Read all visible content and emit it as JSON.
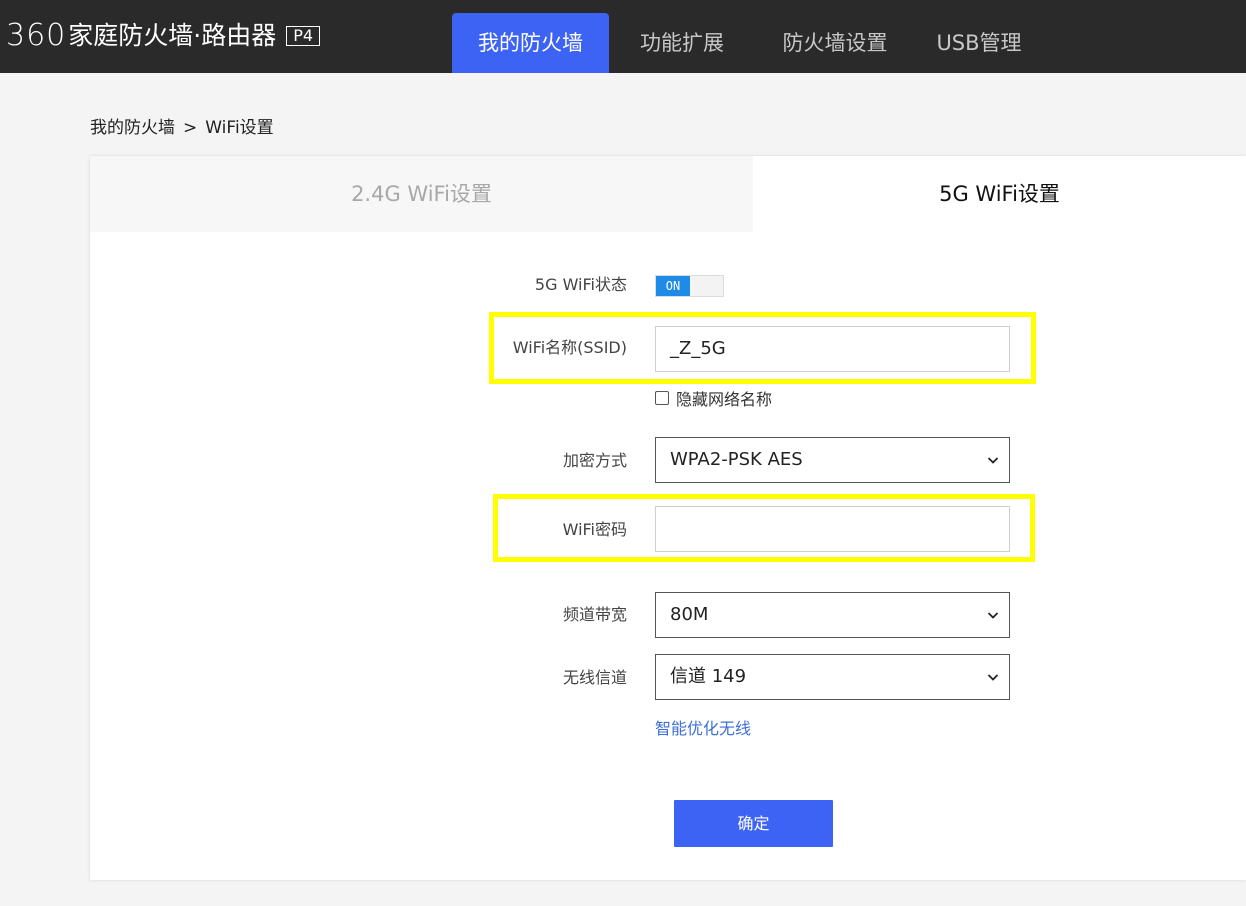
{
  "header": {
    "logo_number": "360",
    "logo_title": "家庭防火墙·路由器",
    "logo_badge": "P4",
    "nav": [
      {
        "label": "我的防火墙",
        "active": true
      },
      {
        "label": "功能扩展",
        "active": false
      },
      {
        "label": "防火墙设置",
        "active": false
      },
      {
        "label": "USB管理",
        "active": false
      }
    ]
  },
  "breadcrumb": {
    "parent": "我的防火墙",
    "separator": ">",
    "current": "WiFi设置"
  },
  "tabs": [
    {
      "label": "2.4G WiFi设置",
      "active": false
    },
    {
      "label": "5G WiFi设置",
      "active": true
    }
  ],
  "form": {
    "wifi_status": {
      "label": "5G WiFi状态",
      "toggle_text": "ON",
      "on": true
    },
    "ssid": {
      "label": "WiFi名称(SSID)",
      "value": "_Z_5G"
    },
    "hide_ssid": {
      "label": "隐藏网络名称",
      "checked": false
    },
    "encryption": {
      "label": "加密方式",
      "value": "WPA2-PSK AES"
    },
    "password": {
      "label": "WiFi密码",
      "value": ""
    },
    "bandwidth": {
      "label": "频道带宽",
      "value": "80M"
    },
    "channel": {
      "label": "无线信道",
      "value": "信道 149"
    },
    "optimize_link": "智能优化无线",
    "submit_label": "确定"
  },
  "colors": {
    "accent": "#3d63f5",
    "topbar": "#2a2a2a",
    "highlight": "#ffff00",
    "link": "#3d6fd8"
  }
}
